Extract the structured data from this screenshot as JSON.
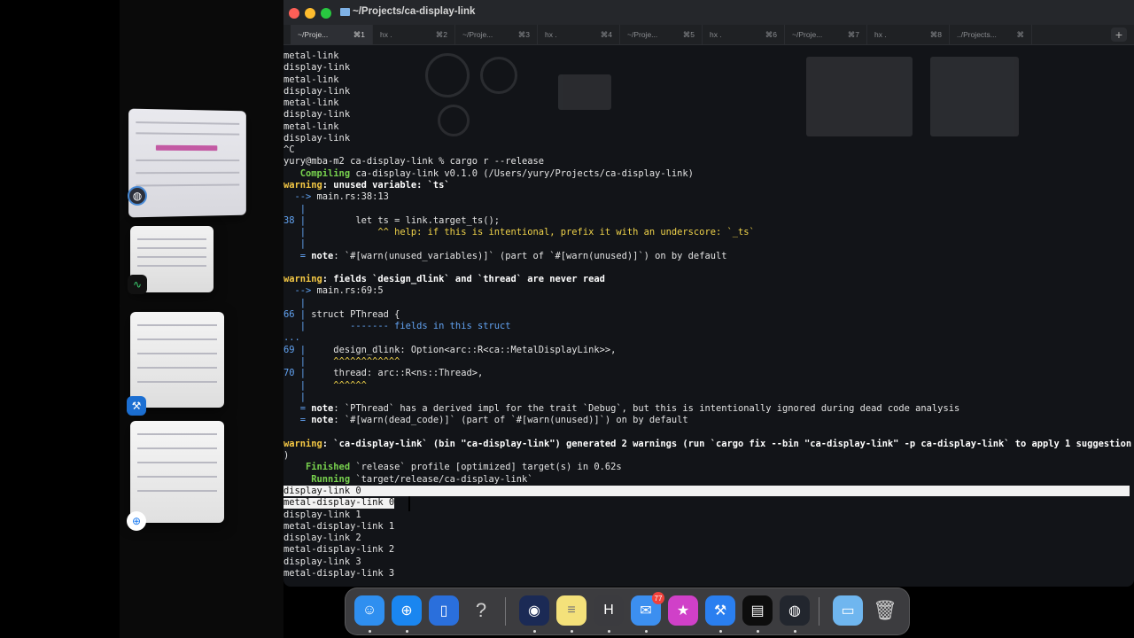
{
  "window": {
    "title": "~/Projects/ca-display-link",
    "tabs": [
      {
        "label": "~/Proje...",
        "shortcut": "⌘1",
        "active": true
      },
      {
        "label": "hx .",
        "shortcut": "⌘2"
      },
      {
        "label": "~/Proje...",
        "shortcut": "⌘3"
      },
      {
        "label": "hx .",
        "shortcut": "⌘4"
      },
      {
        "label": "~/Proje...",
        "shortcut": "⌘5"
      },
      {
        "label": "hx .",
        "shortcut": "⌘6"
      },
      {
        "label": "~/Proje...",
        "shortcut": "⌘7"
      },
      {
        "label": "hx .",
        "shortcut": "⌘8"
      },
      {
        "label": "../Projects...",
        "shortcut": "⌘"
      }
    ],
    "new_tab_label": "+"
  },
  "terminal": {
    "lines": [
      [
        {
          "t": "metal-link"
        }
      ],
      [
        {
          "t": "display-link"
        }
      ],
      [
        {
          "t": "metal-link"
        }
      ],
      [
        {
          "t": "display-link"
        }
      ],
      [
        {
          "t": "metal-link"
        }
      ],
      [
        {
          "t": "display-link"
        }
      ],
      [
        {
          "t": "metal-link"
        }
      ],
      [
        {
          "t": "display-link"
        }
      ],
      [
        {
          "t": "^C"
        }
      ],
      [
        {
          "t": "yury@mba-m2 ca-display-link % cargo r --release"
        }
      ],
      [
        {
          "t": "   Compiling",
          "c": "c-green"
        },
        {
          "t": " ca-display-link v0.1.0 (/Users/yury/Projects/ca-display-link)"
        }
      ],
      [
        {
          "t": "warning",
          "c": "c-warn"
        },
        {
          "t": ": unused variable: `ts`",
          "c": "c-white"
        }
      ],
      [
        {
          "t": "  --> ",
          "c": "c-blue"
        },
        {
          "t": "main.rs:38:13"
        }
      ],
      [
        {
          "t": "   |",
          "c": "c-blue"
        }
      ],
      [
        {
          "t": "38 |",
          "c": "c-blue"
        },
        {
          "t": "         let ts = link.target_ts();"
        }
      ],
      [
        {
          "t": "   |",
          "c": "c-blue"
        },
        {
          "t": "             ^^ help: if this is intentional, prefix it with an underscore: `_ts`",
          "c": "c-yellow"
        }
      ],
      [
        {
          "t": "   |",
          "c": "c-blue"
        }
      ],
      [
        {
          "t": "   = ",
          "c": "c-blue"
        },
        {
          "t": "note",
          "c": "c-white"
        },
        {
          "t": ": `#[warn(unused_variables)]` (part of `#[warn(unused)]`) on by default"
        }
      ],
      [
        {
          "t": ""
        }
      ],
      [
        {
          "t": "warning",
          "c": "c-warn"
        },
        {
          "t": ": fields `design_dlink` and `thread` are never read",
          "c": "c-white"
        }
      ],
      [
        {
          "t": "  --> ",
          "c": "c-blue"
        },
        {
          "t": "main.rs:69:5"
        }
      ],
      [
        {
          "t": "   |",
          "c": "c-blue"
        }
      ],
      [
        {
          "t": "66 |",
          "c": "c-blue"
        },
        {
          "t": " struct PThread {"
        }
      ],
      [
        {
          "t": "   |",
          "c": "c-blue"
        },
        {
          "t": "        ------- fields in this struct",
          "c": "c-blue"
        }
      ],
      [
        {
          "t": "...",
          "c": "c-blue"
        }
      ],
      [
        {
          "t": "69 |",
          "c": "c-blue"
        },
        {
          "t": "     design_dlink: Option<arc::R<ca::MetalDisplayLink>>,"
        }
      ],
      [
        {
          "t": "   |",
          "c": "c-blue"
        },
        {
          "t": "     ^^^^^^^^^^^^",
          "c": "c-yellow"
        }
      ],
      [
        {
          "t": "70 |",
          "c": "c-blue"
        },
        {
          "t": "     thread: arc::R<ns::Thread>,"
        }
      ],
      [
        {
          "t": "   |",
          "c": "c-blue"
        },
        {
          "t": "     ^^^^^^",
          "c": "c-yellow"
        }
      ],
      [
        {
          "t": "   |",
          "c": "c-blue"
        }
      ],
      [
        {
          "t": "   = ",
          "c": "c-blue"
        },
        {
          "t": "note",
          "c": "c-white"
        },
        {
          "t": ": `PThread` has a derived impl for the trait `Debug`, but this is intentionally ignored during dead code analysis"
        }
      ],
      [
        {
          "t": "   = ",
          "c": "c-blue"
        },
        {
          "t": "note",
          "c": "c-white"
        },
        {
          "t": ": `#[warn(dead_code)]` (part of `#[warn(unused)]`) on by default"
        }
      ],
      [
        {
          "t": ""
        }
      ],
      [
        {
          "t": "warning",
          "c": "c-warn"
        },
        {
          "t": ": `ca-display-link` (bin \"ca-display-link\") generated 2 warnings (run `cargo fix --bin \"ca-display-link\" -p ca-display-link` to apply 1 suggestion",
          "c": "c-white"
        }
      ],
      [
        {
          "t": ")"
        }
      ],
      [
        {
          "t": "    Finished",
          "c": "c-green"
        },
        {
          "t": " `release` profile [optimized] target(s) in 0.62s"
        }
      ],
      [
        {
          "t": "     Running",
          "c": "c-green"
        },
        {
          "t": " `target/release/ca-display-link`"
        }
      ],
      [
        {
          "t": "display-link 0",
          "c": "inv",
          "sel": true
        }
      ],
      [
        {
          "t": "metal-display-link 0",
          "c": "inv",
          "sel": true
        }
      ],
      [
        {
          "t": "display-link 1"
        }
      ],
      [
        {
          "t": "metal-display-link 1"
        }
      ],
      [
        {
          "t": "display-link 2"
        }
      ],
      [
        {
          "t": "metal-display-link 2"
        }
      ],
      [
        {
          "t": "display-link 3"
        }
      ],
      [
        {
          "t": "metal-display-link 3"
        }
      ]
    ]
  },
  "dock": {
    "items": [
      {
        "name": "finder-icon",
        "glyph": "☺",
        "color": "#2f8ff0",
        "dot": true
      },
      {
        "name": "safari-icon",
        "glyph": "⊕",
        "color": "#1a86f0",
        "dot": true
      },
      {
        "name": "simulator-icon",
        "glyph": "▯",
        "color": "#2a6fdc",
        "dot": false
      },
      {
        "name": "help-icon",
        "glyph": "?",
        "color": "transparent",
        "dot": false
      },
      {
        "name": "quicktime-icon",
        "glyph": "◉",
        "color": "#1b2a55",
        "dot": true
      },
      {
        "name": "notes-icon",
        "glyph": "≡",
        "color": "#f4e17a",
        "dot": true
      },
      {
        "name": "helix-icon",
        "glyph": "H",
        "color": "#3b3b3f",
        "dot": true
      },
      {
        "name": "mail-icon",
        "glyph": "✉",
        "color": "#3c8ff0",
        "dot": true,
        "badge": "77"
      },
      {
        "name": "star-app-icon",
        "glyph": "★",
        "color": "#d040c8",
        "dot": false
      },
      {
        "name": "xcode-beta-icon",
        "glyph": "⚒",
        "color": "#2a7ff0",
        "dot": true
      },
      {
        "name": "activity-monitor-icon",
        "glyph": "▤",
        "color": "#0d0d0d",
        "dot": true
      },
      {
        "name": "instruments-icon",
        "glyph": "◍",
        "color": "#22262e",
        "dot": true
      },
      {
        "name": "downloads-folder-icon",
        "glyph": "▭",
        "color": "#6fb6ef",
        "dot": false
      },
      {
        "name": "trash-icon",
        "glyph": "🗑",
        "color": "transparent",
        "dot": false
      }
    ]
  }
}
